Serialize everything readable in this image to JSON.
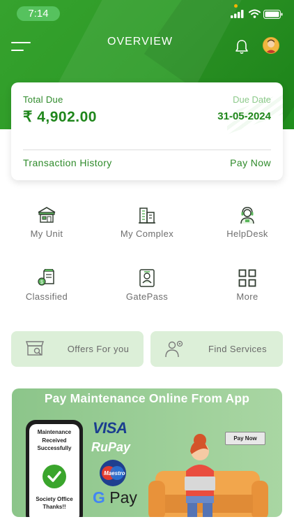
{
  "status_bar": {
    "time": "7:14"
  },
  "header": {
    "title": "OVERVIEW"
  },
  "due_card": {
    "total_due_label": "Total Due",
    "total_due_amount": "₹ 4,902.00",
    "due_date_label": "Due Date",
    "due_date": "31-05-2024",
    "transaction_history_label": "Transaction History",
    "pay_now_label": "Pay Now"
  },
  "quick_actions": [
    {
      "label": "My Unit",
      "icon": "unit-icon"
    },
    {
      "label": "My Complex",
      "icon": "building-icon"
    },
    {
      "label": "HelpDesk",
      "icon": "support-agent-icon"
    },
    {
      "label": "Classified",
      "icon": "classified-icon"
    },
    {
      "label": "GatePass",
      "icon": "id-card-icon"
    },
    {
      "label": "More",
      "icon": "grid-icon"
    }
  ],
  "promos": [
    {
      "label": "Offers For you",
      "icon": "shop-search-icon"
    },
    {
      "label": "Find Services",
      "icon": "service-person-icon"
    }
  ],
  "banner": {
    "title": "Pay Maintenance Online From App",
    "phone_message": "Maintenance Received Successfully",
    "phone_footer": "Society Office Thanks!!",
    "visa": "VISA",
    "rupay": "RuPay",
    "maestro": "Maestro",
    "gpay": "Pay",
    "pay_now_button": "Pay Now"
  },
  "colors": {
    "brand_green": "#2c9a26",
    "accent_text_green": "#1f861b",
    "promo_bg": "#dcefd8"
  }
}
